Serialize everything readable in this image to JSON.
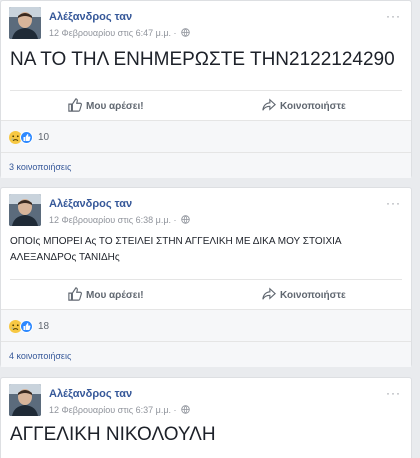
{
  "posts": [
    {
      "author": "Αλέξανδρος ταν",
      "timestamp": "12 Φεβρουαρίου στις 6:47 μ.μ. ·",
      "text": "ΝΑ ΤΟ ΤΗΛ ΕΝΗΜΕΡΩΣΤΕ ΤΗΝ2122124290",
      "like_label": "Μου αρέσει!",
      "share_label": "Κοινοποιήστε",
      "reaction_count": "10",
      "shares_text": "3 κοινοποιήσεις"
    },
    {
      "author": "Αλέξανδρος ταν",
      "timestamp": "12 Φεβρουαρίου στις 6:38 μ.μ. ·",
      "text_line1": "ΟΠΟΙς ΜΠΟΡΕΙ Ας ΤΟ ΣΤΕΙΛΕΙ ΣΤΗΝ ΑΓΓΕΛΙΚΗ ΜΕ ΔΙΚΑ ΜΟΥ ΣΤΟΙΧΙΑ",
      "text_line2": "ΑΛΕΞΑΝΔΡΟς ΤΑΝΙΔΗς",
      "like_label": "Μου αρέσει!",
      "share_label": "Κοινοποιήστε",
      "reaction_count": "18",
      "shares_text": "4 κοινοποιήσεις"
    },
    {
      "author": "Αλέξανδρος ταν",
      "timestamp": "12 Φεβρουαρίου στις 6:37 μ.μ. ·",
      "text": "ΑΓΓΕΛΙΚΗ ΝΙΚΟΛΟΥΛΗ"
    }
  ],
  "more_glyph": "···",
  "icons": [
    "avatar",
    "globe-icon",
    "more-options-icon",
    "like-thumb-icon",
    "share-arrow-icon",
    "sad-reaction-icon",
    "like-reaction-icon"
  ],
  "colors": {
    "author": "#365899",
    "meta": "#90949c",
    "background": "#e9ebee",
    "like_reaction": "#2e89ff",
    "sad_reaction": "#f7c843"
  }
}
